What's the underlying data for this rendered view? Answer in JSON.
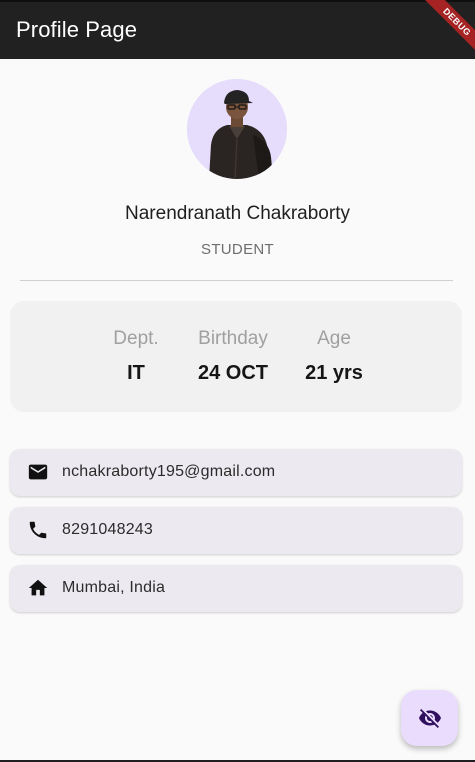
{
  "app_bar": {
    "title": "Profile Page",
    "debug_label": "DEBUG"
  },
  "profile": {
    "name": "Narendranath Chakraborty",
    "role": "STUDENT"
  },
  "stats": [
    {
      "label": "Dept.",
      "value": "IT"
    },
    {
      "label": "Birthday",
      "value": "24 OCT"
    },
    {
      "label": "Age",
      "value": "21 yrs"
    }
  ],
  "contact": {
    "email": "nchakraborty195@gmail.com",
    "phone": "8291048243",
    "address": "Mumbai, India"
  },
  "icons": {
    "email": "mail-icon",
    "phone": "phone-icon",
    "address": "home-icon",
    "fab": "visibility-off-icon"
  },
  "colors": {
    "app_bar": "#212121",
    "avatar_bg": "#e6dcfb",
    "fab_bg": "#eadcfc",
    "fab_icon": "#2f0f5e",
    "tile_bg": "#eceaf0",
    "debug_banner": "#a52323"
  }
}
